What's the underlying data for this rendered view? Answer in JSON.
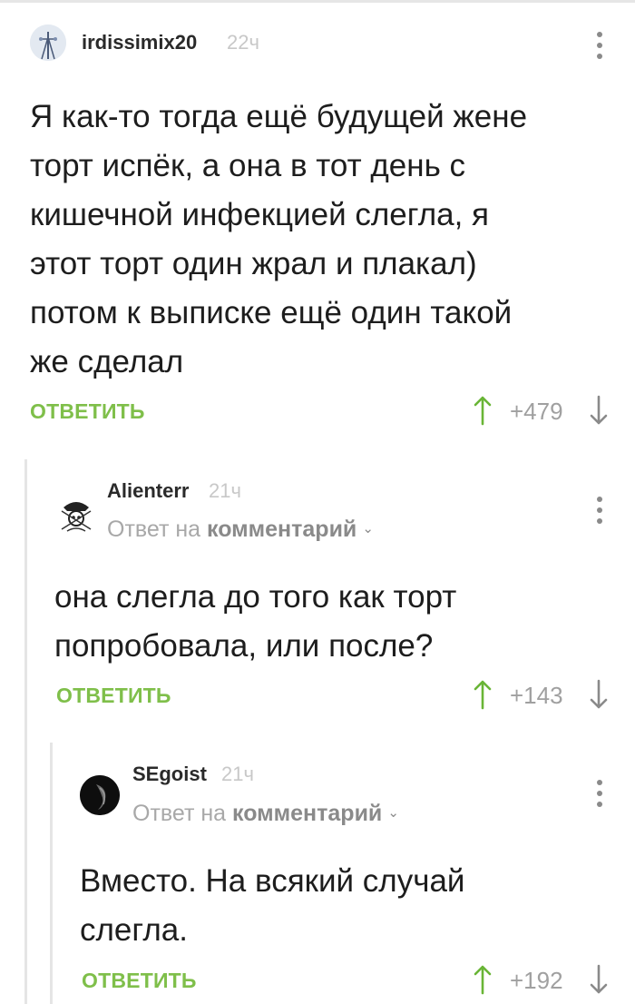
{
  "comments": [
    {
      "author": "irdissimix20",
      "time": "22ч",
      "lines": [
        "Я как-то тогда ещё будущей жене",
        "торт испёк, а она в тот день с",
        "кишечной инфекцией слегла, я",
        "этот торт один жрал и плакал)",
        "потом к выписке ещё один такой",
        "же сделал"
      ],
      "reply_label": "ОТВЕТИТЬ",
      "rating": "+479"
    },
    {
      "author": "Alienterr",
      "time": "21ч",
      "reply_to_prefix": "Ответ на",
      "reply_to_target": "комментарий",
      "lines": [
        "она слегла до того как торт",
        "попробовала, или после?"
      ],
      "reply_label": "ОТВЕТИТЬ",
      "rating": "+143"
    },
    {
      "author": "SEgoist",
      "time": "21ч",
      "reply_to_prefix": "Ответ на",
      "reply_to_target": "комментарий",
      "lines": [
        "Вместо. На всякий случай",
        "слегла."
      ],
      "reply_label": "ОТВЕТИТЬ",
      "rating": "+192"
    }
  ],
  "colors": {
    "accent_green": "#7fbf4a",
    "upvote_green": "#69b536",
    "thread_line": "#e5e5e5"
  }
}
